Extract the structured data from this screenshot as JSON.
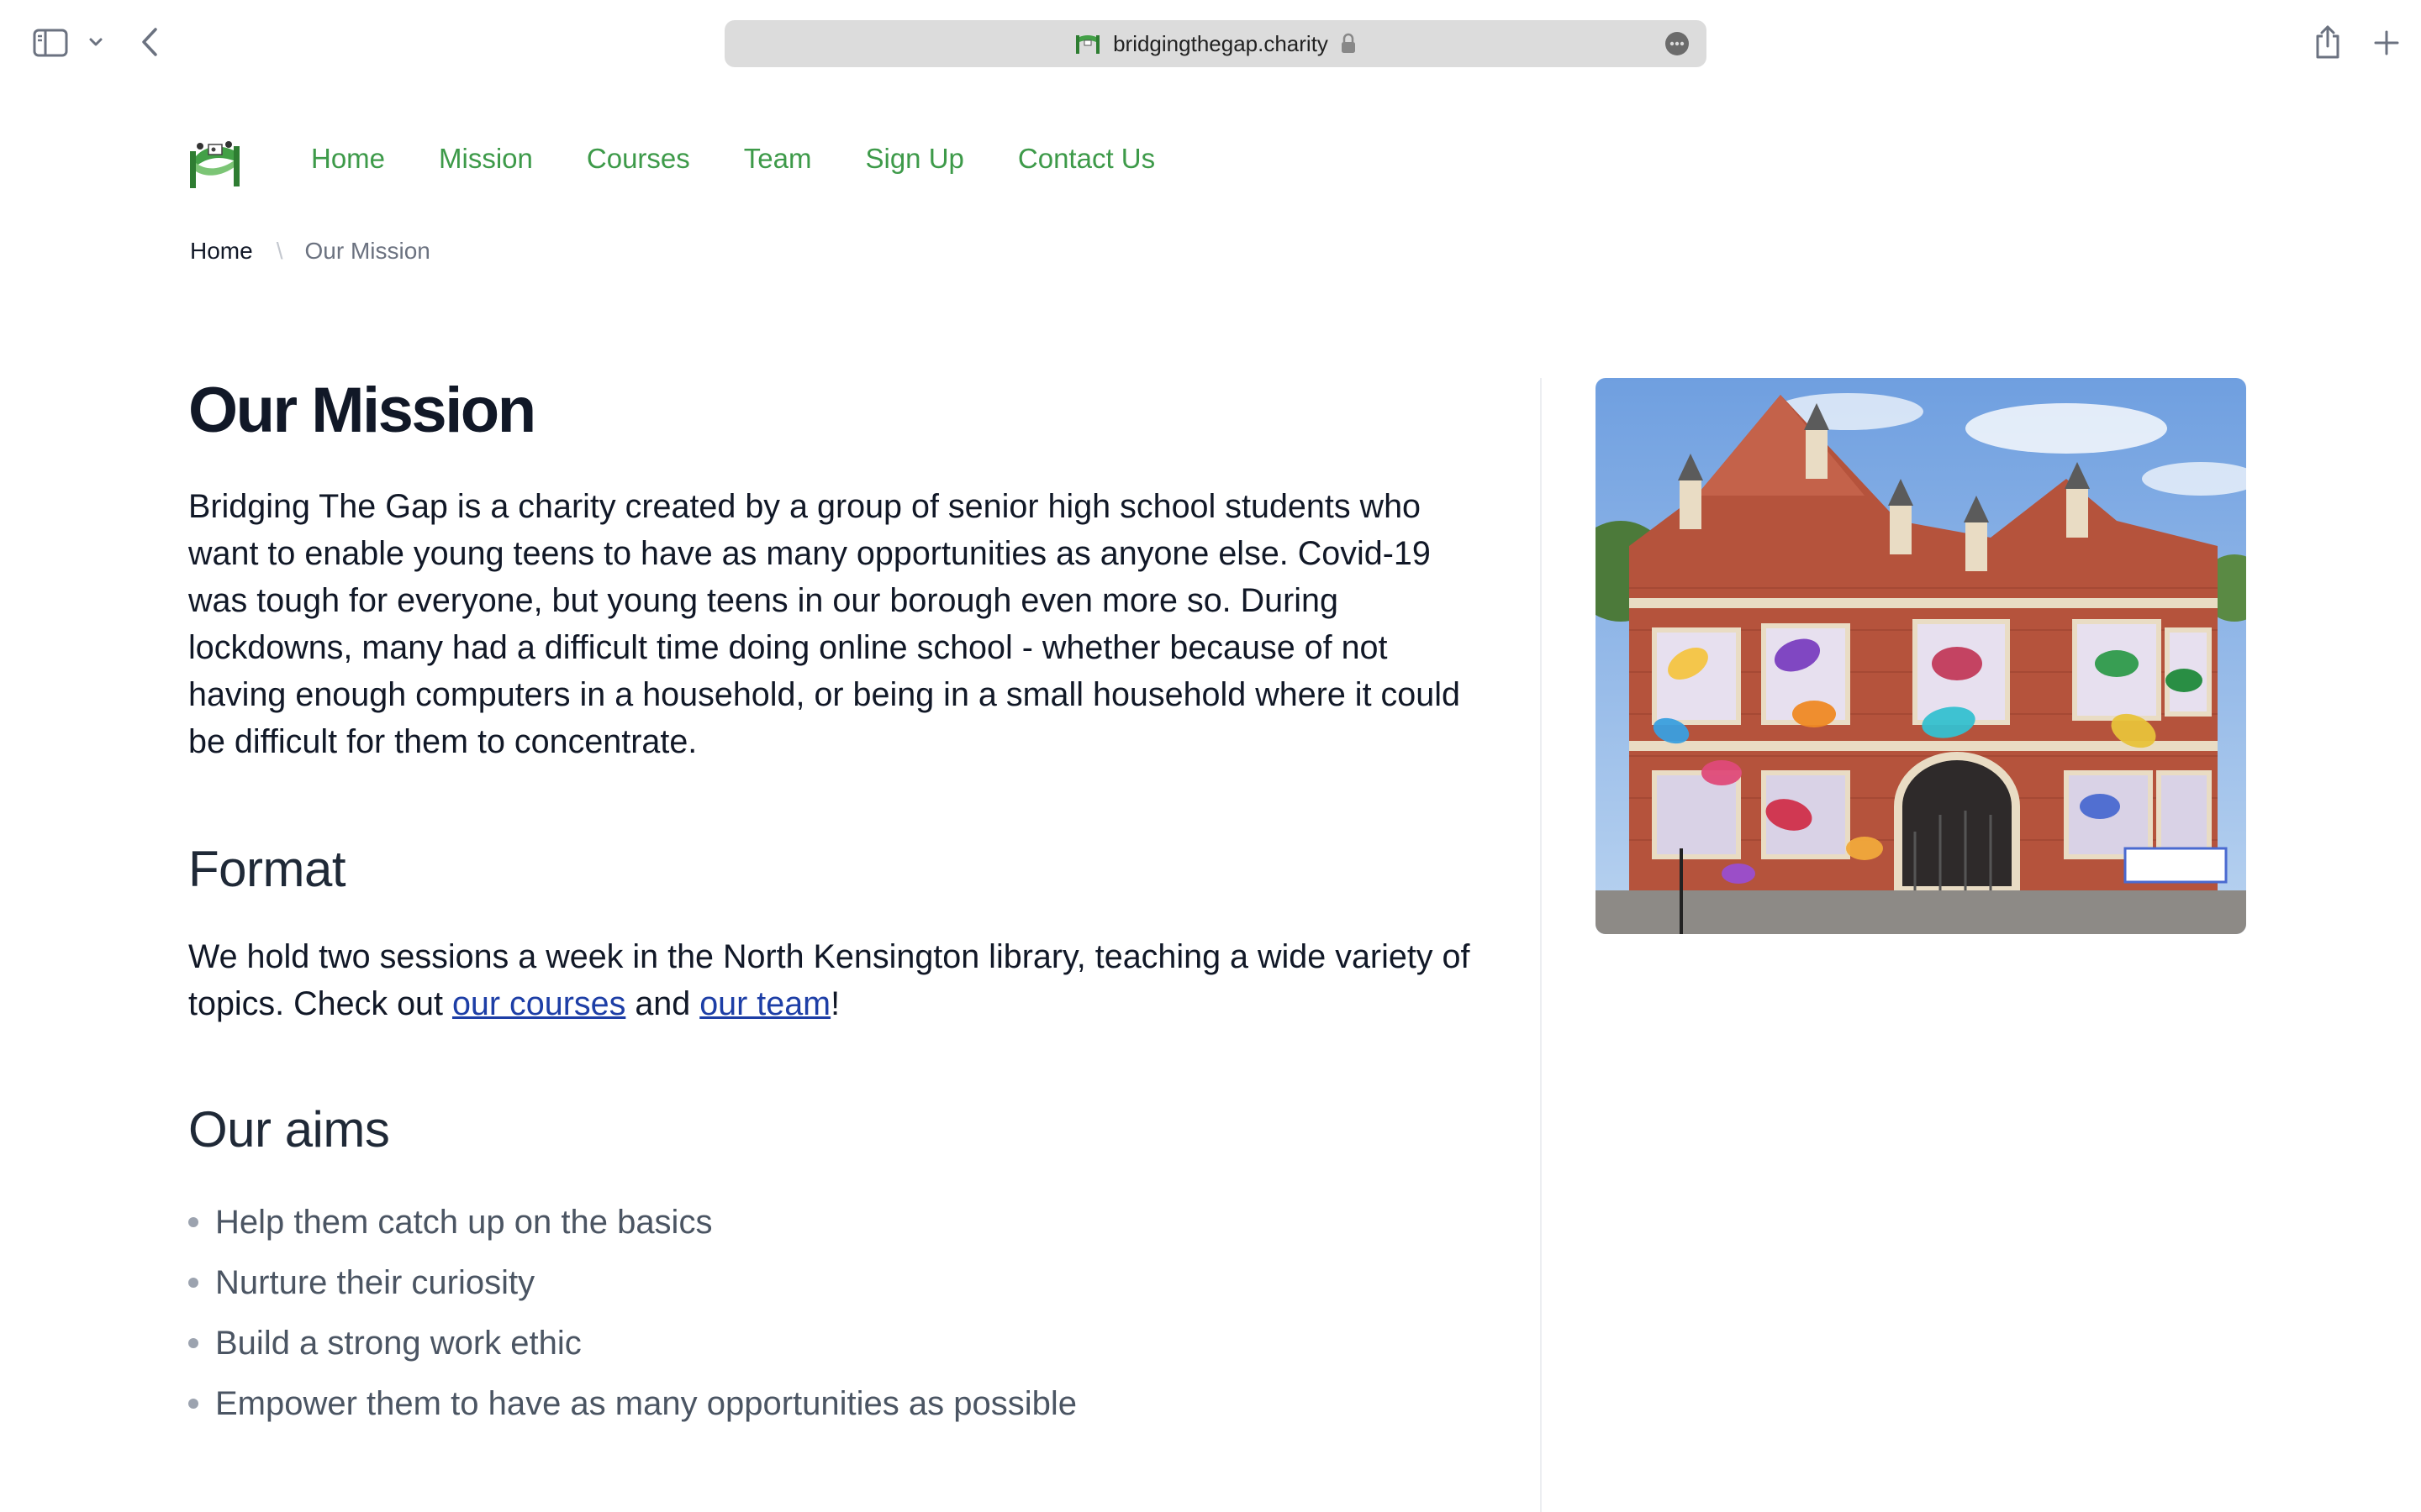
{
  "browser": {
    "url": "bridgingthegap.charity",
    "icons": [
      "sidebar-icon",
      "chevron-down-icon",
      "back-arrow-icon",
      "lock-icon",
      "more-icon",
      "share-icon",
      "plus-icon"
    ]
  },
  "nav": {
    "logo_icon": "bridging-the-gap-logo",
    "items": [
      {
        "label": "Home"
      },
      {
        "label": "Mission"
      },
      {
        "label": "Courses"
      },
      {
        "label": "Team"
      },
      {
        "label": "Sign Up"
      },
      {
        "label": "Contact Us"
      }
    ],
    "color": "#3d9a49"
  },
  "breadcrumb": {
    "home": "Home",
    "separator": "\\",
    "current": "Our Mission"
  },
  "page": {
    "title": "Our Mission",
    "intro": "Bridging The Gap is a charity created by a group of senior high school students who want to enable young teens to have as many opportunities as anyone else. Covid-19 was tough for everyone, but young teens in our borough even more so. During lockdowns, many had a difficult time doing online school - whether because of not having enough computers in a household, or being in a small household where it could be difficult for them to concentrate.",
    "format": {
      "heading": "Format",
      "text_before": "We hold two sessions a week in the North Kensington library, teaching a wide variety of topics. Check out ",
      "link_courses": "our courses",
      "text_middle": " and ",
      "link_team": "our team",
      "text_after": "!"
    },
    "aims": {
      "heading": "Our aims",
      "items": [
        "Help them catch up on the basics",
        "Nurture their curiosity",
        "Build a strong work ethic",
        "Empower them to have as many opportunities as possible"
      ]
    },
    "image_icon": "library-building-photo"
  },
  "colors": {
    "link": "#1d3ea6",
    "heading": "#111827",
    "muted": "#4b5563"
  }
}
